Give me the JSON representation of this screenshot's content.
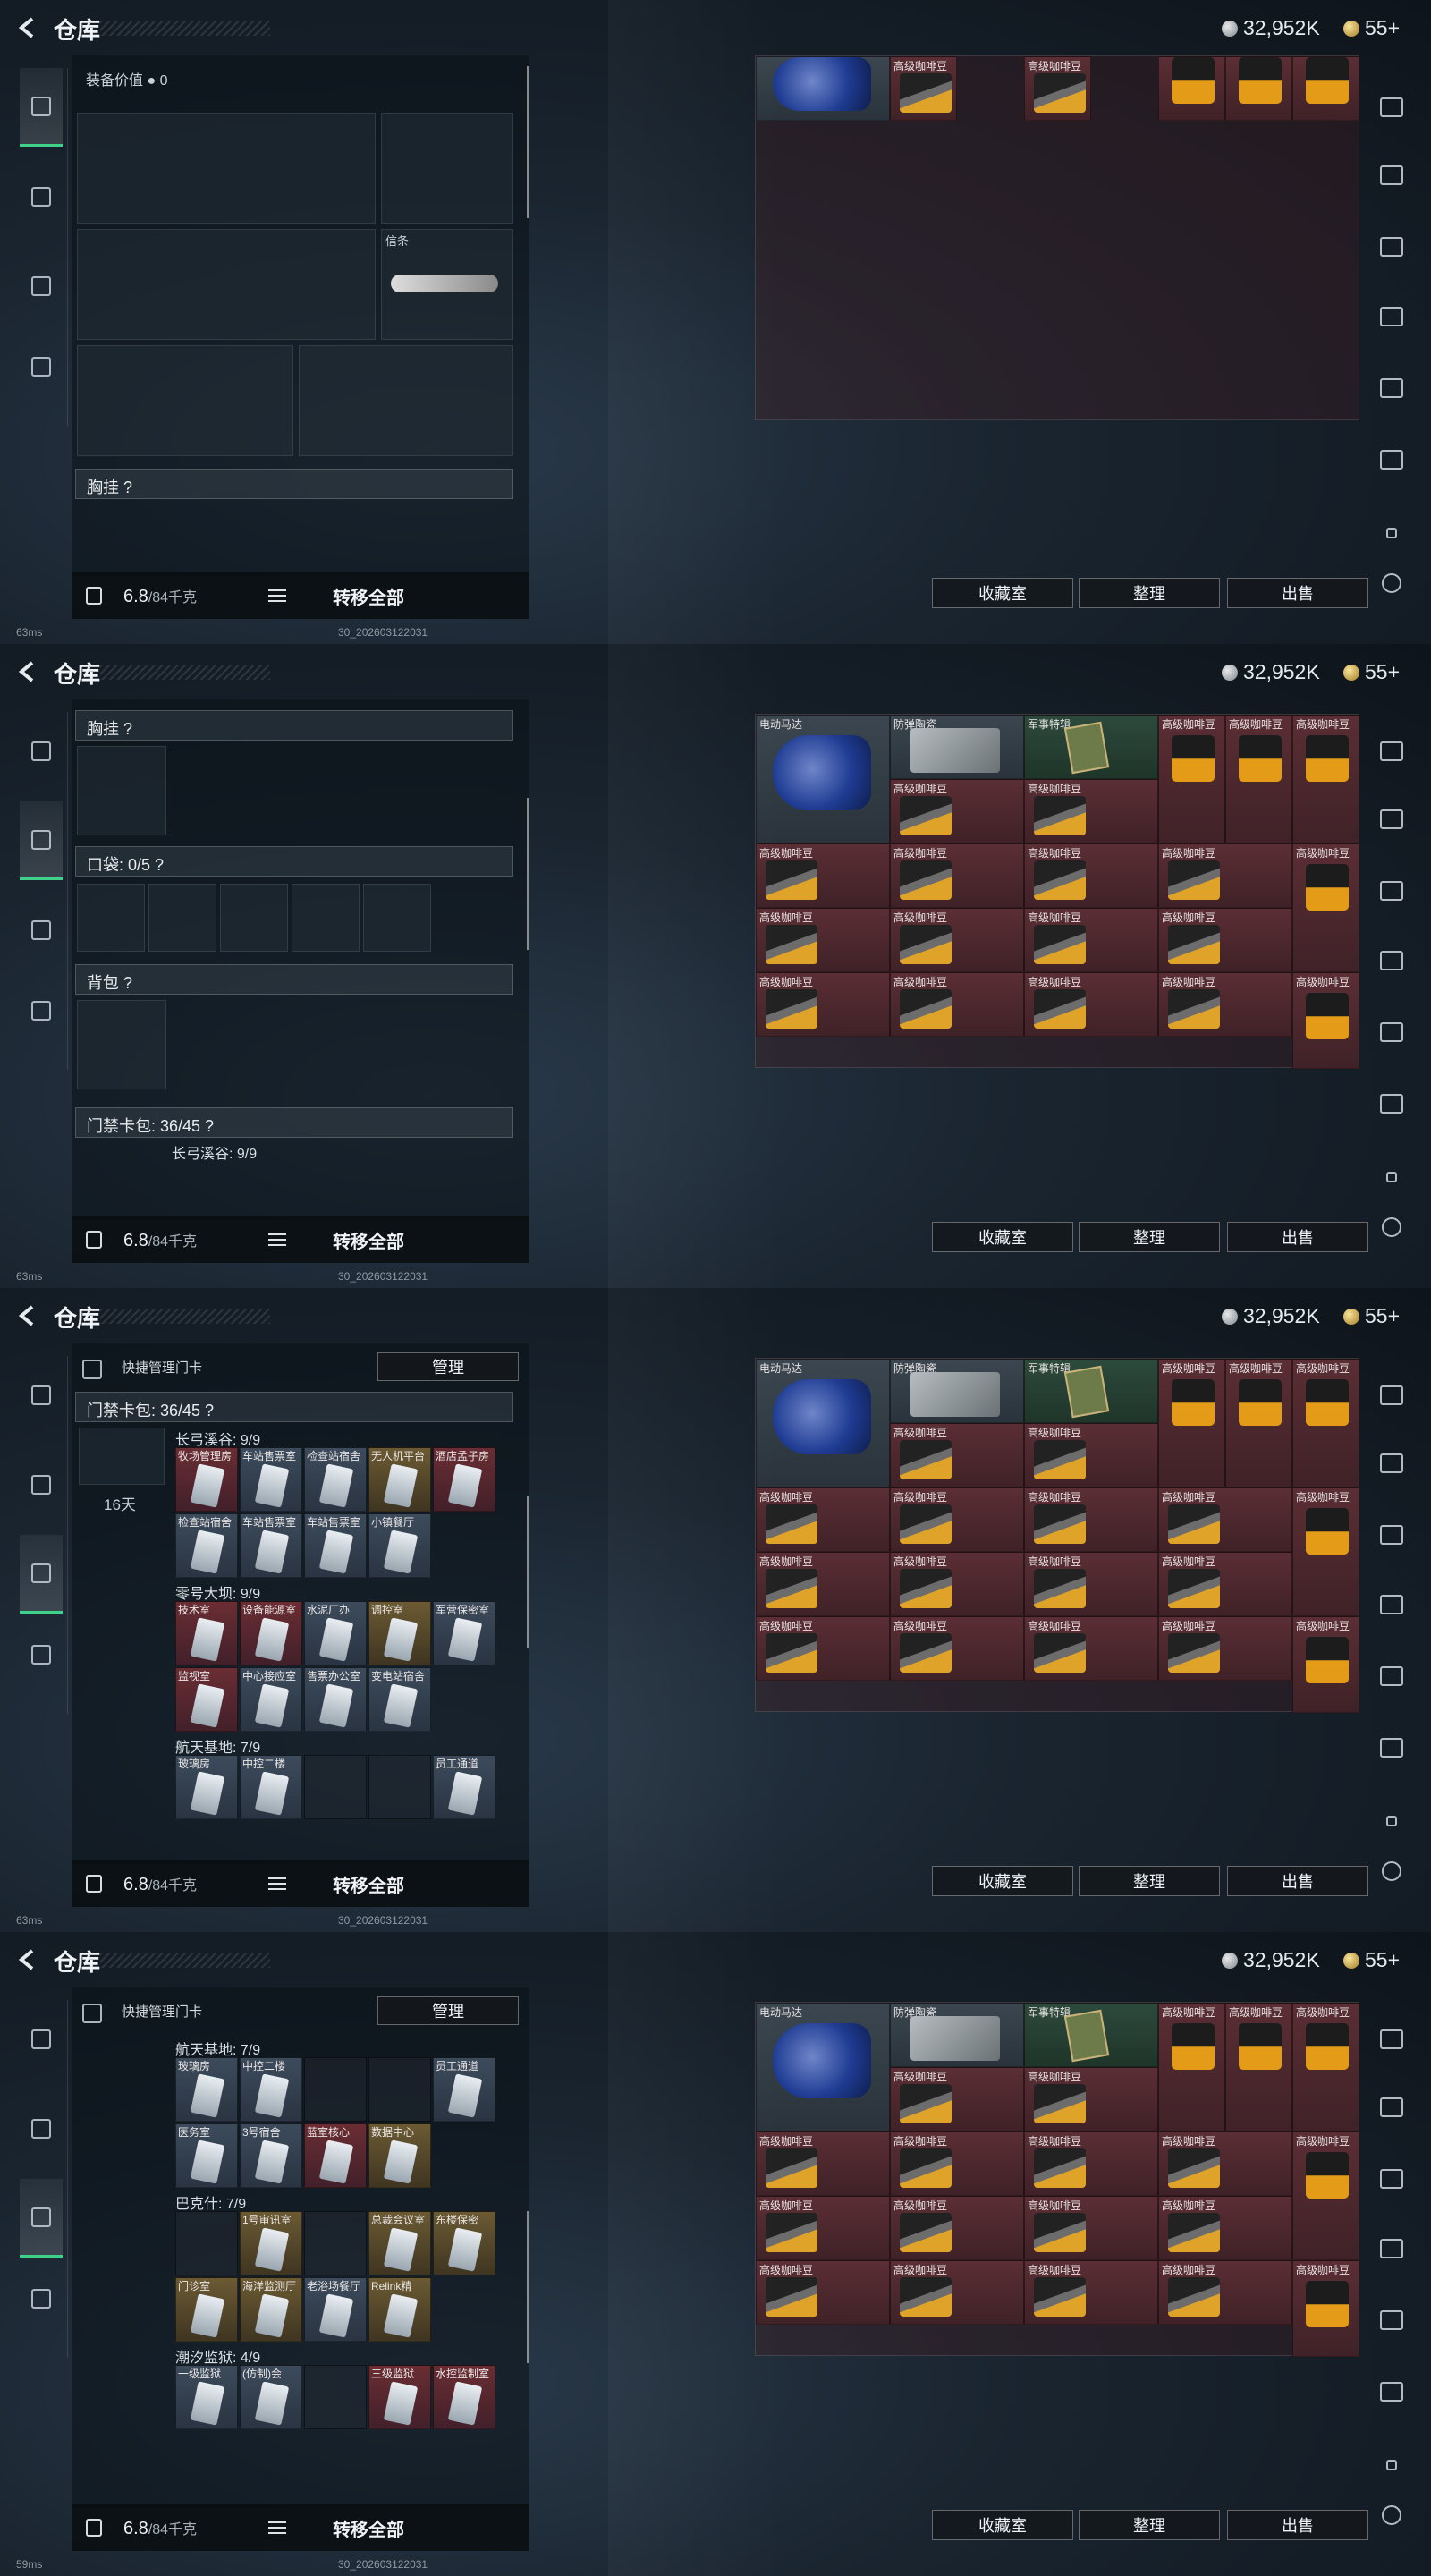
{
  "title": "仓库",
  "currency": {
    "silver": "32,952K",
    "gold": "55+"
  },
  "equip": {
    "value_label": "装备价值",
    "value": "0",
    "melee_label": "信条",
    "chest_rig": "胸挂 ?",
    "pockets": "口袋: 0/5 ?",
    "backpack": "背包 ?",
    "keycard_case": "门禁卡包: 36/45 ?",
    "keycard_timer": "16天"
  },
  "bottom": {
    "weight": "6.8",
    "weight_max": "/84千克",
    "transfer_all": "转移全部"
  },
  "buttons": {
    "collection": "收藏室",
    "sort": "整理",
    "sell": "出售",
    "manage": "管理",
    "quick_manage": "快捷管理门卡"
  },
  "grid": {
    "labels": {
      "motor": "电动马达",
      "plate": "防弹陶瓷",
      "book": "军事特辑",
      "coffee": "高级咖啡豆"
    }
  },
  "keycards": {
    "groups": [
      {
        "name": "长弓溪谷: 9/9",
        "cards": [
          "牧场管理房",
          "车站售票室",
          "检查站宿舍",
          "无人机平台",
          "酒店孟子房",
          "检查站宿舍",
          "车站售票室",
          "车站售票室",
          "小镇餐厅"
        ]
      },
      {
        "name": "零号大坝: 9/9",
        "cards": [
          "技术室",
          "设备能源室",
          "水泥厂办",
          "调控室",
          "军营保密室",
          "监视室",
          "中心接应室",
          "售票办公室",
          "变电站宿舍"
        ]
      },
      {
        "name": "航天基地: 7/9",
        "cards": [
          "玻璃房",
          "中控二楼",
          "",
          "",
          "员工通道",
          "医务室",
          "3号宿舍",
          "蓝室核心",
          "数据中心"
        ]
      },
      {
        "name": "巴克什: 7/9",
        "cards": [
          "",
          "1号审讯室",
          "",
          "总裁会议室",
          "东楼保密",
          "门诊室",
          "海洋监测厅",
          "老浴场餐厅",
          "Relink精"
        ]
      },
      {
        "name": "潮汐监狱: 4/9",
        "cards": [
          "一级监狱",
          "(仿制)会",
          "",
          "三级监狱",
          "水控监制室"
        ]
      }
    ]
  },
  "status": {
    "ping1": "63ms",
    "ping2": "59ms",
    "build": "30_202603122031"
  }
}
